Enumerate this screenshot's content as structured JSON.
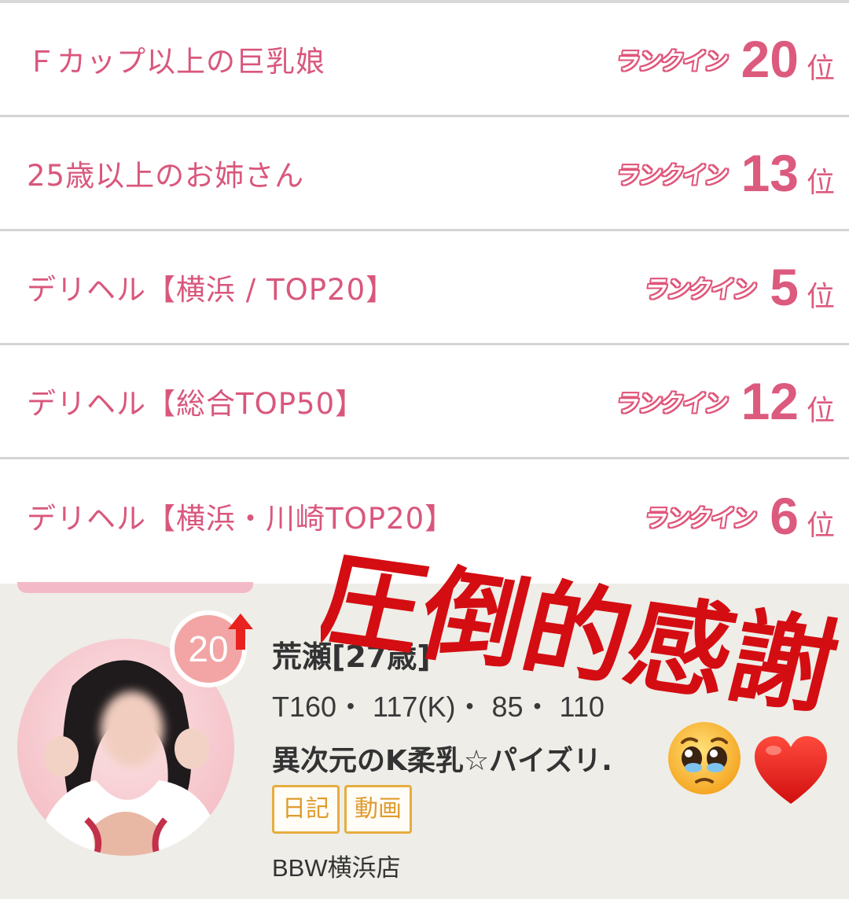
{
  "ranking": {
    "badge_label": "ランクイン",
    "rank_unit": "位",
    "rows": [
      {
        "category": "Ｆカップ以上の巨乳娘",
        "rank": "20"
      },
      {
        "category": "25歳以上のお姉さん",
        "rank": "13"
      },
      {
        "category": "デリヘル【横浜 / TOP20】",
        "rank": "5"
      },
      {
        "category": "デリヘル【総合TOP50】",
        "rank": "12"
      },
      {
        "category": "デリヘル【横浜・川崎TOP20】",
        "rank": "6"
      }
    ]
  },
  "overlay": {
    "caption": "圧倒的感謝",
    "caption_color": "#d40d12",
    "emojis": [
      "pleading-face-icon",
      "red-heart-icon"
    ]
  },
  "profile": {
    "rank_badge": "20",
    "rank_trend": "up-arrow-icon",
    "name": "荒瀬[27歳]",
    "stats": "T160・ 117(K)・ 85・ 110",
    "catchphrase": "異次元のK柔乳☆パイズリ.",
    "tags": [
      "日記",
      "動画"
    ],
    "shop": "BBW横浜店"
  },
  "colors": {
    "accent_pink": "#dc5a7e",
    "tag_orange": "#e6ad3f",
    "card_background": "#eeede8",
    "rank_circle": "#f2a5a4"
  }
}
